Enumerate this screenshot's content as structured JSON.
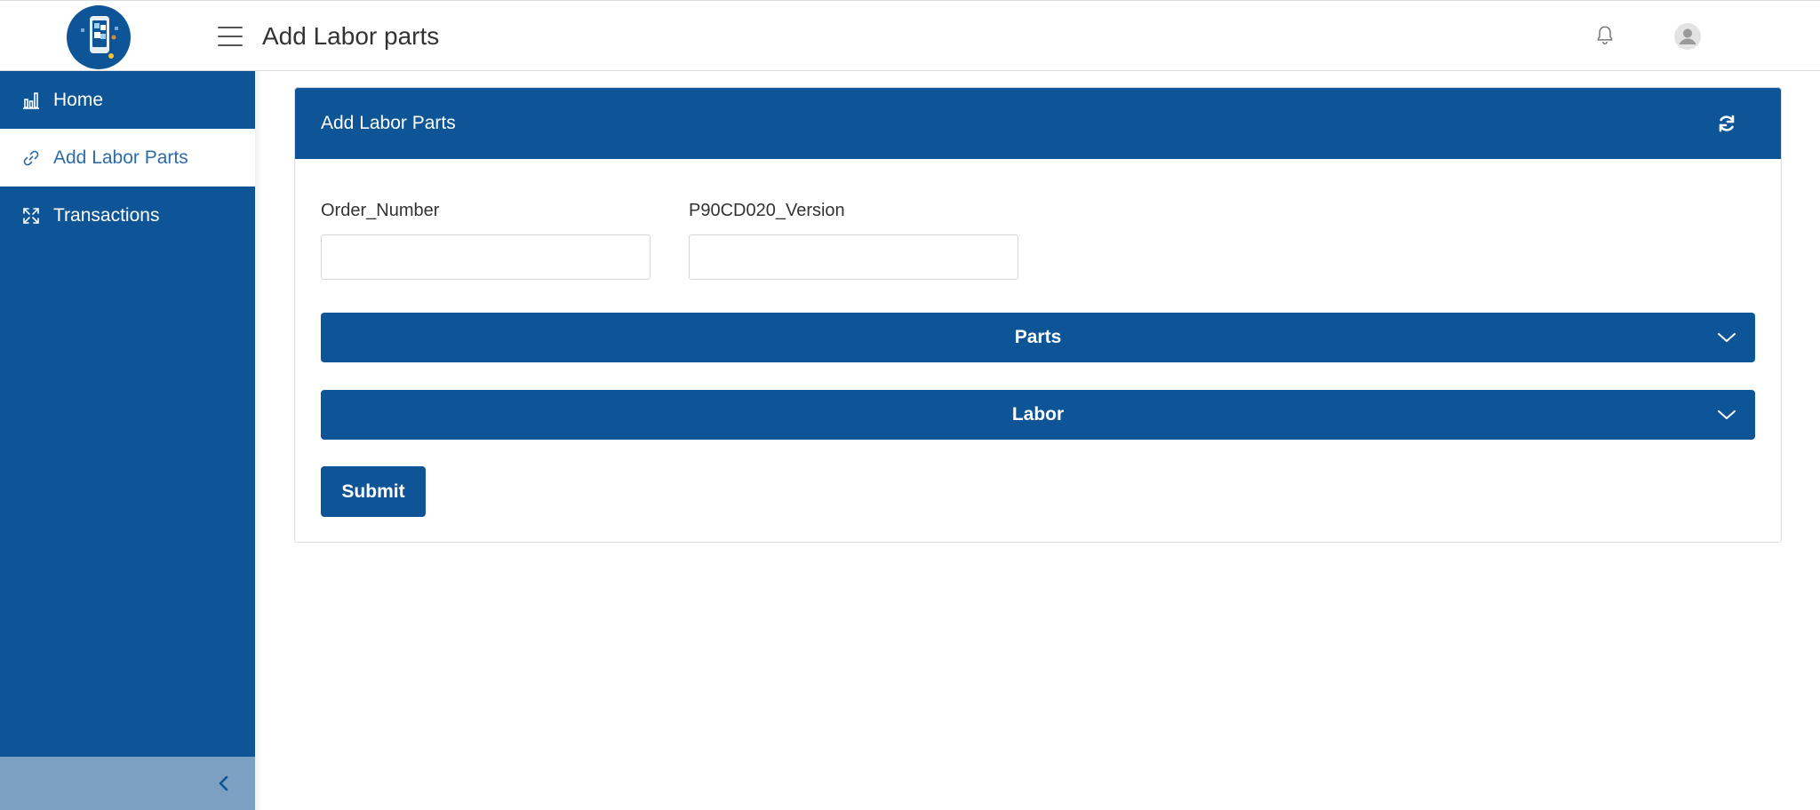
{
  "header": {
    "title": "Add Labor parts",
    "icons": {
      "menu": "hamburger-icon",
      "notifications": "bell-icon",
      "profile": "user-avatar-icon"
    }
  },
  "sidebar": {
    "items": [
      {
        "label": "Home",
        "icon": "bar-chart-icon",
        "active": false
      },
      {
        "label": "Add Labor Parts",
        "icon": "link-icon",
        "active": true
      },
      {
        "label": "Transactions",
        "icon": "expand-icon",
        "active": false
      }
    ],
    "collapse_icon": "chevron-left-icon"
  },
  "card": {
    "title": "Add Labor Parts",
    "refresh_icon": "refresh-icon",
    "fields": [
      {
        "label": "Order_Number",
        "value": "",
        "placeholder": ""
      },
      {
        "label": "P90CD020_Version",
        "value": "",
        "placeholder": ""
      }
    ],
    "sections": [
      {
        "label": "Parts",
        "expanded": false
      },
      {
        "label": "Labor",
        "expanded": false
      }
    ],
    "submit_label": "Submit"
  },
  "colors": {
    "primary": "#0e5597",
    "sidebar_footer": "#7ba0c2",
    "active_text": "#2e6ca8",
    "border": "#d6dde6"
  }
}
